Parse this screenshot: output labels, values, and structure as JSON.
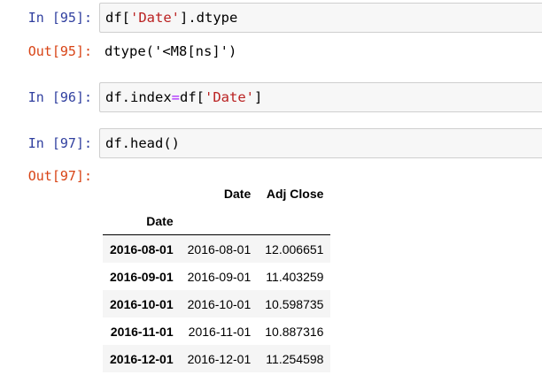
{
  "cells": [
    {
      "in_prompt": "In [95]:",
      "code": [
        {
          "t": "df[",
          "k": "plain"
        },
        {
          "t": "'Date'",
          "k": "str"
        },
        {
          "t": "].dtype",
          "k": "plain"
        }
      ],
      "out_prompt": "Out[95]:",
      "output": "dtype('<M8[ns]')"
    },
    {
      "in_prompt": "In [96]:",
      "code": [
        {
          "t": "df.index",
          "k": "plain"
        },
        {
          "t": "=",
          "k": "op"
        },
        {
          "t": "df[",
          "k": "plain"
        },
        {
          "t": "'Date'",
          "k": "str"
        },
        {
          "t": "]",
          "k": "plain"
        }
      ]
    },
    {
      "in_prompt": "In [97]:",
      "code": [
        {
          "t": "df.head()",
          "k": "plain"
        }
      ],
      "out_prompt": "Out[97]:"
    }
  ],
  "dataframe": {
    "columns": [
      "Date",
      "Adj Close"
    ],
    "index_name": "Date",
    "rows": [
      {
        "index": "2016-08-01",
        "values": [
          "2016-08-01",
          "12.006651"
        ]
      },
      {
        "index": "2016-09-01",
        "values": [
          "2016-09-01",
          "11.403259"
        ]
      },
      {
        "index": "2016-10-01",
        "values": [
          "2016-10-01",
          "10.598735"
        ]
      },
      {
        "index": "2016-11-01",
        "values": [
          "2016-11-01",
          "10.887316"
        ]
      },
      {
        "index": "2016-12-01",
        "values": [
          "2016-12-01",
          "11.254598"
        ]
      }
    ]
  },
  "colors": {
    "in_prompt": "#303F9F",
    "out_prompt": "#D84315",
    "string": "#BA2121",
    "operator": "#AA22FF"
  }
}
